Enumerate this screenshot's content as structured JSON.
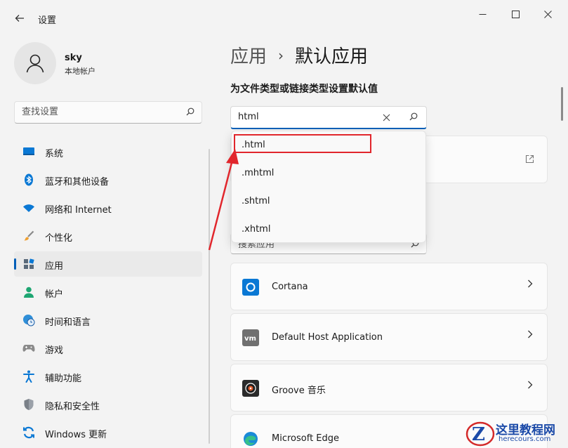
{
  "window": {
    "title": "设置",
    "back_icon": "arrow-left-icon",
    "minimize_icon": "minimize-icon",
    "maximize_icon": "maximize-icon",
    "close_icon": "close-icon"
  },
  "user": {
    "name": "sky",
    "account_type": "本地帐户"
  },
  "nav_search": {
    "placeholder": "查找设置"
  },
  "nav": {
    "items": [
      {
        "label": "系统",
        "icon": "monitor-icon"
      },
      {
        "label": "蓝牙和其他设备",
        "icon": "bluetooth-icon"
      },
      {
        "label": "网络和 Internet",
        "icon": "wifi-icon"
      },
      {
        "label": "个性化",
        "icon": "brush-icon"
      },
      {
        "label": "应用",
        "icon": "apps-icon",
        "active": true
      },
      {
        "label": "帐户",
        "icon": "person-icon"
      },
      {
        "label": "时间和语言",
        "icon": "globe-clock-icon"
      },
      {
        "label": "游戏",
        "icon": "gamepad-icon"
      },
      {
        "label": "辅助功能",
        "icon": "accessibility-icon"
      },
      {
        "label": "隐私和安全性",
        "icon": "shield-icon"
      },
      {
        "label": "Windows 更新",
        "icon": "update-icon"
      }
    ]
  },
  "main": {
    "breadcrumb_parent": "应用",
    "breadcrumb_current": "默认应用",
    "section_title": "为文件类型或链接类型设置默认值",
    "ext_search": {
      "value": "html"
    },
    "suggestions": [
      ".html",
      ".mhtml",
      ".shtml",
      ".xhtml"
    ],
    "app_search": {
      "placeholder": "搜索应用"
    },
    "apps": [
      {
        "name": "Cortana",
        "icon": "cortana-icon"
      },
      {
        "name": "Default Host Application",
        "icon": "vm-icon"
      },
      {
        "name": "Groove 音乐",
        "icon": "groove-music-icon"
      },
      {
        "name": "Microsoft Edge",
        "icon": "edge-icon"
      }
    ]
  },
  "watermark": {
    "title": "这里教程网",
    "url": "herecours.com",
    "logo_letter": "Z"
  },
  "colors": {
    "accent": "#005fb8",
    "highlight": "#e1262c",
    "watermark": "#1b4aa8"
  }
}
